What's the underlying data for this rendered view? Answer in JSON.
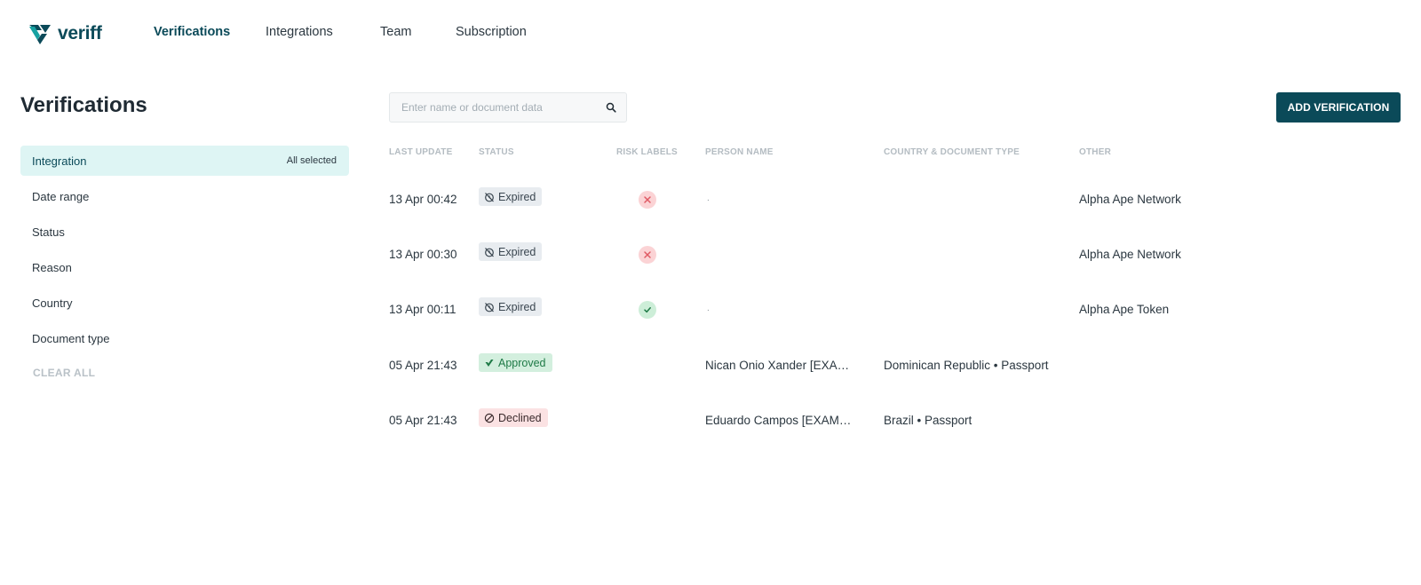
{
  "brand": {
    "name": "veriff"
  },
  "nav": {
    "items": [
      {
        "label": "Verifications",
        "active": true
      },
      {
        "label": "Integrations"
      },
      {
        "label": "Team"
      },
      {
        "label": "Subscription"
      }
    ]
  },
  "page": {
    "title": "Verifications"
  },
  "filters": [
    {
      "label": "Integration",
      "value": "All selected",
      "active": true
    },
    {
      "label": "Date range"
    },
    {
      "label": "Status"
    },
    {
      "label": "Reason"
    },
    {
      "label": "Country"
    },
    {
      "label": "Document type"
    }
  ],
  "clear_all_label": "CLEAR ALL",
  "search": {
    "placeholder": "Enter name or document data",
    "value": ""
  },
  "add_button_label": "ADD VERIFICATION",
  "table": {
    "columns": [
      "LAST UPDATE",
      "STATUS",
      "RISK LABELS",
      "PERSON NAME",
      "COUNTRY & DOCUMENT TYPE",
      "OTHER"
    ],
    "rows": [
      {
        "date": "13 Apr 00:42",
        "status": "Expired",
        "risk": "negative",
        "person": ".",
        "country": "",
        "other": "Alpha Ape Network"
      },
      {
        "date": "13 Apr 00:30",
        "status": "Expired",
        "risk": "negative",
        "person": "",
        "country": "",
        "other": "Alpha Ape Network"
      },
      {
        "date": "13 Apr 00:11",
        "status": "Expired",
        "risk": "positive",
        "person": ".",
        "country": "",
        "other": "Alpha Ape Token"
      },
      {
        "date": "05 Apr 21:43",
        "status": "Approved",
        "risk": "",
        "person": "Nican Onio Xander [EXAMPLE]",
        "country": "Dominican Republic • Passport",
        "other": ""
      },
      {
        "date": "05 Apr 21:43",
        "status": "Declined",
        "risk": "",
        "person": "Eduardo Campos [EXAMPLE]",
        "country": "Brazil • Passport",
        "other": ""
      }
    ]
  },
  "colors": {
    "brand": "#0b4a59",
    "active_filter_bg": "#def5f4",
    "expired_bg": "#e8ecf0",
    "approved_bg": "#d3efde",
    "declined_bg": "#fbe2e3",
    "risk_negative": "#fbd3d5",
    "risk_positive": "#cdeed8"
  }
}
